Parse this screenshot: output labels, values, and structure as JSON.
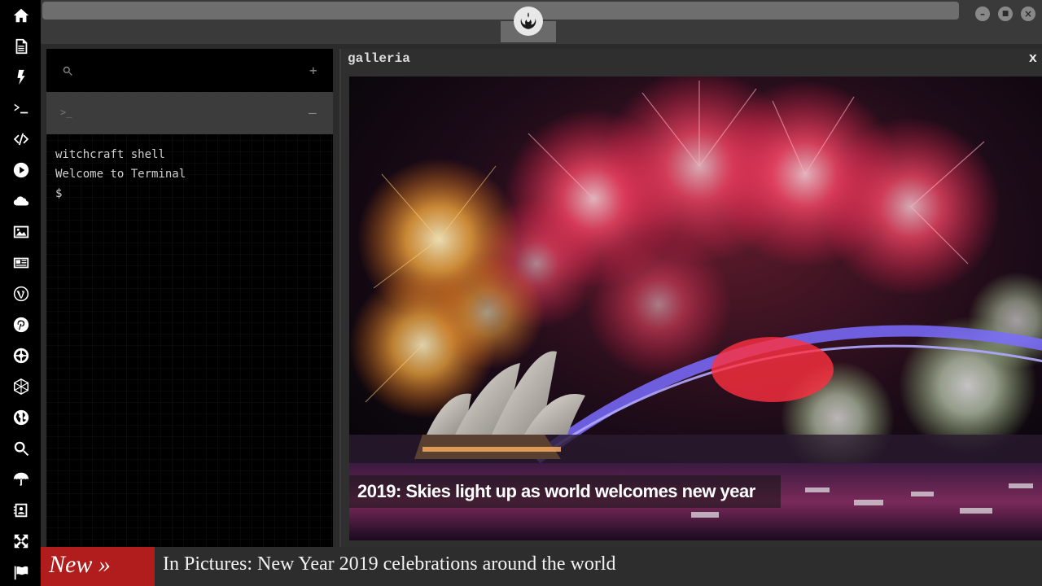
{
  "dock": {
    "items": [
      {
        "name": "home-icon"
      },
      {
        "name": "document-icon"
      },
      {
        "name": "bolt-icon"
      },
      {
        "name": "terminal-icon"
      },
      {
        "name": "code-icon"
      },
      {
        "name": "play-icon"
      },
      {
        "name": "cloud-icon"
      },
      {
        "name": "image-icon"
      },
      {
        "name": "newspaper-icon"
      },
      {
        "name": "wordpress-icon"
      },
      {
        "name": "pinterest-icon"
      },
      {
        "name": "galactic-empire-icon"
      },
      {
        "name": "network-sphere-icon"
      },
      {
        "name": "globe-icon"
      },
      {
        "name": "search-icon"
      },
      {
        "name": "umbrella-icon"
      },
      {
        "name": "contact-card-icon"
      },
      {
        "name": "expand-arrows-icon"
      },
      {
        "name": "flag-icon"
      }
    ]
  },
  "topbar": {
    "logo_icon": "rebel-alliance-icon",
    "window_controls": {
      "minimize": "–",
      "maximize": "■",
      "close": "×"
    }
  },
  "terminal": {
    "search_icon": "search-icon",
    "add_label": "+",
    "prompt_icon": ">_",
    "collapse_label": "–",
    "lines": [
      "witchcraft shell",
      "Welcome to Terminal",
      "$"
    ]
  },
  "gallery": {
    "title": "galleria",
    "close_label": "x",
    "caption": "2019: Skies light up as world welcomes new year"
  },
  "ticker": {
    "badge": "New »",
    "headline": "In Pictures: New Year 2019 celebrations around the world",
    "accent_color": "#b11c1c"
  }
}
